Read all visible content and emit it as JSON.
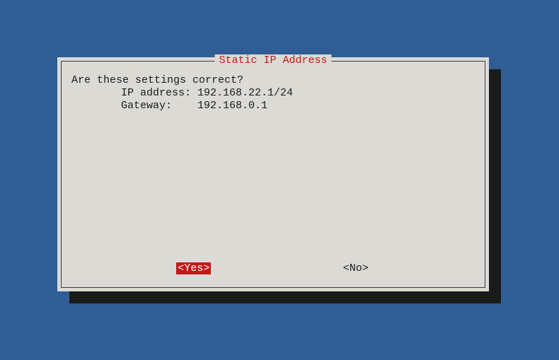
{
  "dialog": {
    "title": "Static IP Address",
    "prompt": "Are these settings correct?",
    "fields": [
      {
        "label": "IP address: ",
        "value": "192.168.22.1/24"
      },
      {
        "label": "Gateway:    ",
        "value": "192.168.0.1"
      }
    ],
    "buttons": {
      "yes": "<Yes>",
      "no": "<No>"
    },
    "selected": "yes"
  },
  "colors": {
    "background": "#2f5d94",
    "dialog_bg": "#dcdad5",
    "title_color": "#c21818",
    "highlight_bg": "#c21818",
    "highlight_fg": "#ffffff"
  }
}
